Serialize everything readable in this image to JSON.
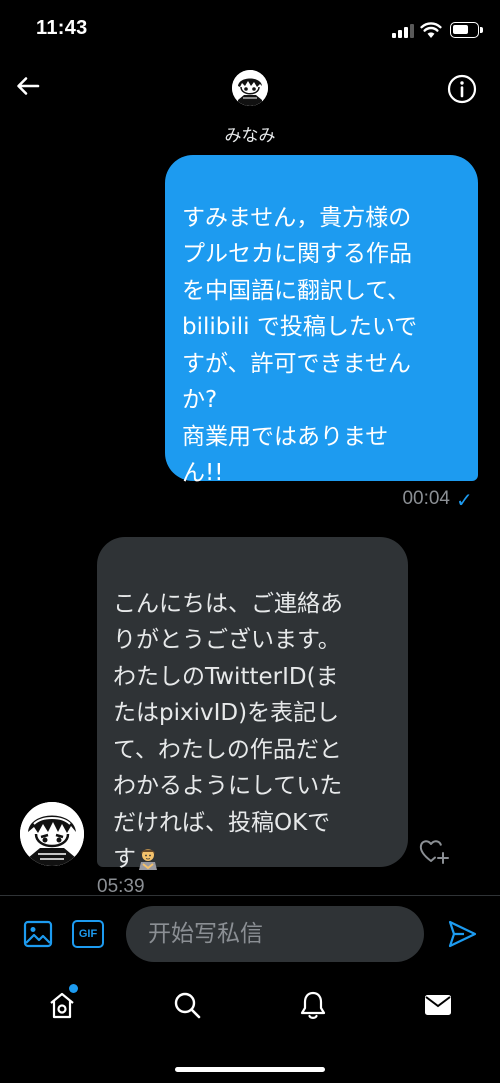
{
  "status_bar": {
    "time": "11:43",
    "battery_level": 0.7
  },
  "header": {
    "contact_name": "みなみ",
    "back_icon": "arrow-left-icon",
    "info_icon": "info-icon"
  },
  "messages": {
    "sent": {
      "text": "すみません，貴方様の\nプルセカに関する作品\nを中国語に翻訳して、\nbilibili で投稿したいで\nすが、許可できません\nか?\n商業用ではありませ\nん!!",
      "time": "00:04",
      "status": "✓"
    },
    "received": {
      "text": "こんにちは、ご連絡あ\nりがとうございます。\nわたしのTwitterID(ま\nたはpixivID)を表記し\nて、わたしの作品だと\nわかるようにしていた\nだければ、投稿OKで\nす",
      "emoji": "person-bowing-emoji",
      "time": "05:39"
    }
  },
  "compose": {
    "placeholder": "开始写私信",
    "gif_label": "GIF",
    "media_icon": "image-icon",
    "send_icon": "send-icon"
  },
  "tabbar": {
    "items": [
      "home-icon",
      "search-icon",
      "bell-icon",
      "mail-icon"
    ]
  },
  "colors": {
    "accent": "#1d9bf0",
    "sent_bubble": "#1d9bf0",
    "received_bubble": "#2f3336",
    "background": "#000000",
    "muted_text": "#8b8f94"
  }
}
